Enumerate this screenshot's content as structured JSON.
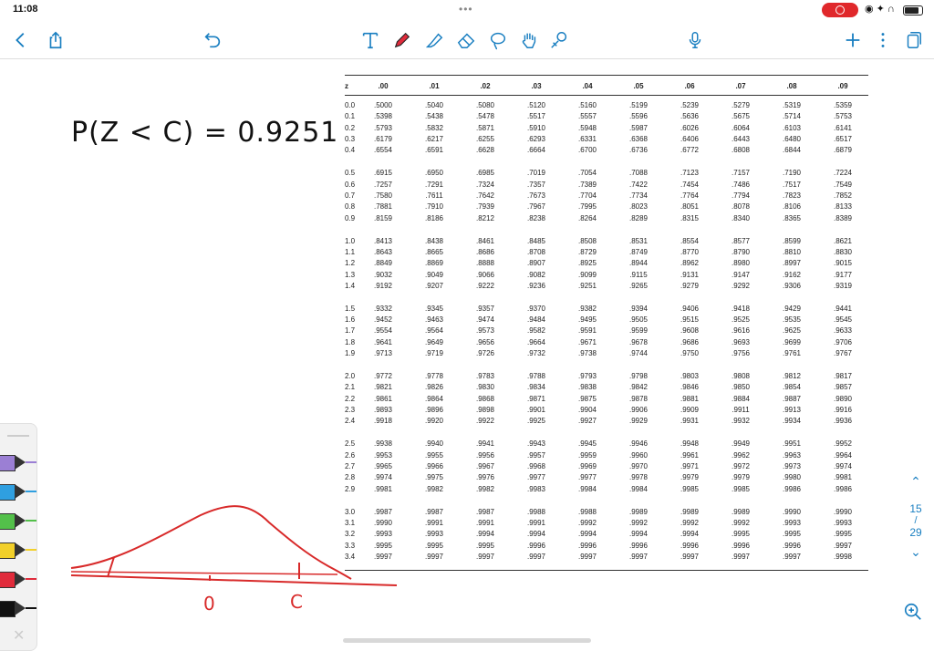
{
  "status": {
    "time": "11:08",
    "indicators": "◉ ✦ ∩",
    "dots": "•••"
  },
  "toolbar": {
    "icons": [
      "back-icon",
      "share-icon",
      "undo-icon",
      "text-tool-icon",
      "pen-icon",
      "highlighter-icon",
      "eraser-icon",
      "lasso-icon",
      "hand-icon",
      "shapes-icon",
      "mic-icon",
      "add-icon",
      "more-icon",
      "pages-icon"
    ]
  },
  "accent_color": "#1a7fc1",
  "handwriting": {
    "equation": "P(Z < C) = 0.9251",
    "axis_mark_0": "0",
    "axis_mark_c": "C"
  },
  "z_table": {
    "header_z": "z",
    "columns": [
      ".00",
      ".01",
      ".02",
      ".03",
      ".04",
      ".05",
      ".06",
      ".07",
      ".08",
      ".09"
    ],
    "rows": [
      [
        "0.0",
        ".5000",
        ".5040",
        ".5080",
        ".5120",
        ".5160",
        ".5199",
        ".5239",
        ".5279",
        ".5319",
        ".5359"
      ],
      [
        "0.1",
        ".5398",
        ".5438",
        ".5478",
        ".5517",
        ".5557",
        ".5596",
        ".5636",
        ".5675",
        ".5714",
        ".5753"
      ],
      [
        "0.2",
        ".5793",
        ".5832",
        ".5871",
        ".5910",
        ".5948",
        ".5987",
        ".6026",
        ".6064",
        ".6103",
        ".6141"
      ],
      [
        "0.3",
        ".6179",
        ".6217",
        ".6255",
        ".6293",
        ".6331",
        ".6368",
        ".6406",
        ".6443",
        ".6480",
        ".6517"
      ],
      [
        "0.4",
        ".6554",
        ".6591",
        ".6628",
        ".6664",
        ".6700",
        ".6736",
        ".6772",
        ".6808",
        ".6844",
        ".6879"
      ],
      [
        "0.5",
        ".6915",
        ".6950",
        ".6985",
        ".7019",
        ".7054",
        ".7088",
        ".7123",
        ".7157",
        ".7190",
        ".7224"
      ],
      [
        "0.6",
        ".7257",
        ".7291",
        ".7324",
        ".7357",
        ".7389",
        ".7422",
        ".7454",
        ".7486",
        ".7517",
        ".7549"
      ],
      [
        "0.7",
        ".7580",
        ".7611",
        ".7642",
        ".7673",
        ".7704",
        ".7734",
        ".7764",
        ".7794",
        ".7823",
        ".7852"
      ],
      [
        "0.8",
        ".7881",
        ".7910",
        ".7939",
        ".7967",
        ".7995",
        ".8023",
        ".8051",
        ".8078",
        ".8106",
        ".8133"
      ],
      [
        "0.9",
        ".8159",
        ".8186",
        ".8212",
        ".8238",
        ".8264",
        ".8289",
        ".8315",
        ".8340",
        ".8365",
        ".8389"
      ],
      [
        "1.0",
        ".8413",
        ".8438",
        ".8461",
        ".8485",
        ".8508",
        ".8531",
        ".8554",
        ".8577",
        ".8599",
        ".8621"
      ],
      [
        "1.1",
        ".8643",
        ".8665",
        ".8686",
        ".8708",
        ".8729",
        ".8749",
        ".8770",
        ".8790",
        ".8810",
        ".8830"
      ],
      [
        "1.2",
        ".8849",
        ".8869",
        ".8888",
        ".8907",
        ".8925",
        ".8944",
        ".8962",
        ".8980",
        ".8997",
        ".9015"
      ],
      [
        "1.3",
        ".9032",
        ".9049",
        ".9066",
        ".9082",
        ".9099",
        ".9115",
        ".9131",
        ".9147",
        ".9162",
        ".9177"
      ],
      [
        "1.4",
        ".9192",
        ".9207",
        ".9222",
        ".9236",
        ".9251",
        ".9265",
        ".9279",
        ".9292",
        ".9306",
        ".9319"
      ],
      [
        "1.5",
        ".9332",
        ".9345",
        ".9357",
        ".9370",
        ".9382",
        ".9394",
        ".9406",
        ".9418",
        ".9429",
        ".9441"
      ],
      [
        "1.6",
        ".9452",
        ".9463",
        ".9474",
        ".9484",
        ".9495",
        ".9505",
        ".9515",
        ".9525",
        ".9535",
        ".9545"
      ],
      [
        "1.7",
        ".9554",
        ".9564",
        ".9573",
        ".9582",
        ".9591",
        ".9599",
        ".9608",
        ".9616",
        ".9625",
        ".9633"
      ],
      [
        "1.8",
        ".9641",
        ".9649",
        ".9656",
        ".9664",
        ".9671",
        ".9678",
        ".9686",
        ".9693",
        ".9699",
        ".9706"
      ],
      [
        "1.9",
        ".9713",
        ".9719",
        ".9726",
        ".9732",
        ".9738",
        ".9744",
        ".9750",
        ".9756",
        ".9761",
        ".9767"
      ],
      [
        "2.0",
        ".9772",
        ".9778",
        ".9783",
        ".9788",
        ".9793",
        ".9798",
        ".9803",
        ".9808",
        ".9812",
        ".9817"
      ],
      [
        "2.1",
        ".9821",
        ".9826",
        ".9830",
        ".9834",
        ".9838",
        ".9842",
        ".9846",
        ".9850",
        ".9854",
        ".9857"
      ],
      [
        "2.2",
        ".9861",
        ".9864",
        ".9868",
        ".9871",
        ".9875",
        ".9878",
        ".9881",
        ".9884",
        ".9887",
        ".9890"
      ],
      [
        "2.3",
        ".9893",
        ".9896",
        ".9898",
        ".9901",
        ".9904",
        ".9906",
        ".9909",
        ".9911",
        ".9913",
        ".9916"
      ],
      [
        "2.4",
        ".9918",
        ".9920",
        ".9922",
        ".9925",
        ".9927",
        ".9929",
        ".9931",
        ".9932",
        ".9934",
        ".9936"
      ],
      [
        "2.5",
        ".9938",
        ".9940",
        ".9941",
        ".9943",
        ".9945",
        ".9946",
        ".9948",
        ".9949",
        ".9951",
        ".9952"
      ],
      [
        "2.6",
        ".9953",
        ".9955",
        ".9956",
        ".9957",
        ".9959",
        ".9960",
        ".9961",
        ".9962",
        ".9963",
        ".9964"
      ],
      [
        "2.7",
        ".9965",
        ".9966",
        ".9967",
        ".9968",
        ".9969",
        ".9970",
        ".9971",
        ".9972",
        ".9973",
        ".9974"
      ],
      [
        "2.8",
        ".9974",
        ".9975",
        ".9976",
        ".9977",
        ".9977",
        ".9978",
        ".9979",
        ".9979",
        ".9980",
        ".9981"
      ],
      [
        "2.9",
        ".9981",
        ".9982",
        ".9982",
        ".9983",
        ".9984",
        ".9984",
        ".9985",
        ".9985",
        ".9986",
        ".9986"
      ],
      [
        "3.0",
        ".9987",
        ".9987",
        ".9987",
        ".9988",
        ".9988",
        ".9989",
        ".9989",
        ".9989",
        ".9990",
        ".9990"
      ],
      [
        "3.1",
        ".9990",
        ".9991",
        ".9991",
        ".9991",
        ".9992",
        ".9992",
        ".9992",
        ".9992",
        ".9993",
        ".9993"
      ],
      [
        "3.2",
        ".9993",
        ".9993",
        ".9994",
        ".9994",
        ".9994",
        ".9994",
        ".9994",
        ".9995",
        ".9995",
        ".9995"
      ],
      [
        "3.3",
        ".9995",
        ".9995",
        ".9995",
        ".9996",
        ".9996",
        ".9996",
        ".9996",
        ".9996",
        ".9996",
        ".9997"
      ],
      [
        "3.4",
        ".9997",
        ".9997",
        ".9997",
        ".9997",
        ".9997",
        ".9997",
        ".9997",
        ".9997",
        ".9997",
        ".9998"
      ]
    ]
  },
  "pen_tray": {
    "pens": [
      {
        "name": "pen-purple",
        "color": "#9b7fd4"
      },
      {
        "name": "pen-blue",
        "color": "#2f9fe0"
      },
      {
        "name": "pen-green",
        "color": "#53c04a"
      },
      {
        "name": "pen-yellow",
        "color": "#f2d02a"
      },
      {
        "name": "pen-red",
        "color": "#e02b3b"
      },
      {
        "name": "pen-black",
        "color": "#111111"
      }
    ]
  },
  "page": {
    "current": "15",
    "separator": "/",
    "total": "29"
  }
}
